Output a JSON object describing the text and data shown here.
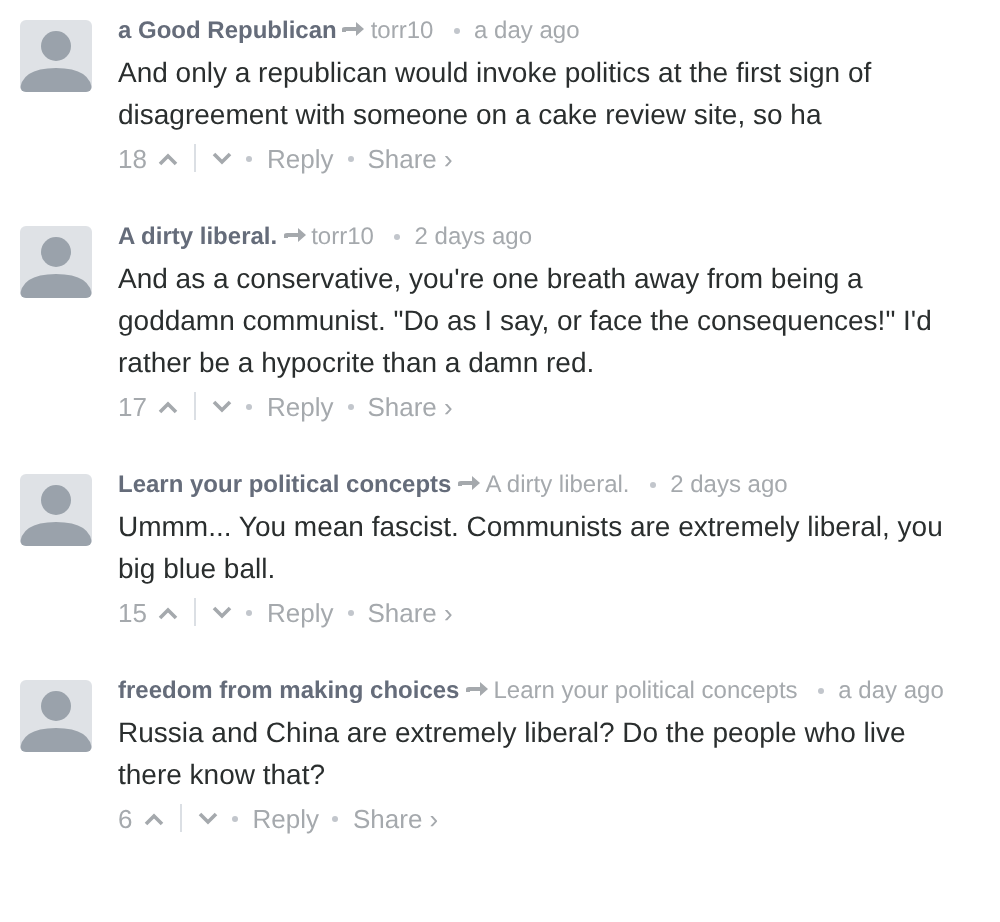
{
  "comments": [
    {
      "author": "a Good Republican",
      "in_reply_to": "torr10",
      "time": "a day ago",
      "text": "And only a republican would invoke politics at the first sign of disagreement with someone on a cake review site, so ha",
      "votes": "18",
      "reply": "Reply",
      "share": "Share ›"
    },
    {
      "author": "A dirty liberal.",
      "in_reply_to": "torr10",
      "time": "2 days ago",
      "text": "And as a conservative, you're one breath away from being a goddamn communist. \"Do as I say, or face the consequences!\" I'd rather be a hypocrite than a damn red.",
      "votes": "17",
      "reply": "Reply",
      "share": "Share ›"
    },
    {
      "author": "Learn your political concepts",
      "in_reply_to": "A dirty liberal.",
      "time": "2 days ago",
      "text": "Ummm... You mean fascist. Communists are extremely liberal, you big blue ball.",
      "votes": "15",
      "reply": "Reply",
      "share": "Share ›"
    },
    {
      "author": "freedom from making choices",
      "in_reply_to": "Learn your political concepts",
      "time": "a day ago",
      "text": "Russia and China are extremely liberal? Do the people who live there know that?",
      "votes": "6",
      "reply": "Reply",
      "share": "Share ›"
    }
  ]
}
